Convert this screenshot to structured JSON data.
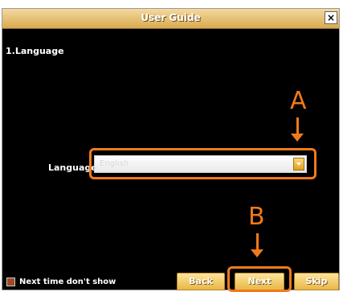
{
  "window": {
    "title": "User Guide",
    "close_glyph": "×"
  },
  "step": {
    "heading": "1.Language"
  },
  "language": {
    "label": "Language",
    "selected": "English"
  },
  "callouts": {
    "a": "A",
    "b": "B"
  },
  "footer": {
    "checkbox_label": "Next time don't show",
    "back_label": "Back",
    "next_label": "Next",
    "skip_label": "Skip"
  },
  "colors": {
    "accent": "#f07a1a",
    "button": "#e8b648",
    "background": "#000000"
  }
}
